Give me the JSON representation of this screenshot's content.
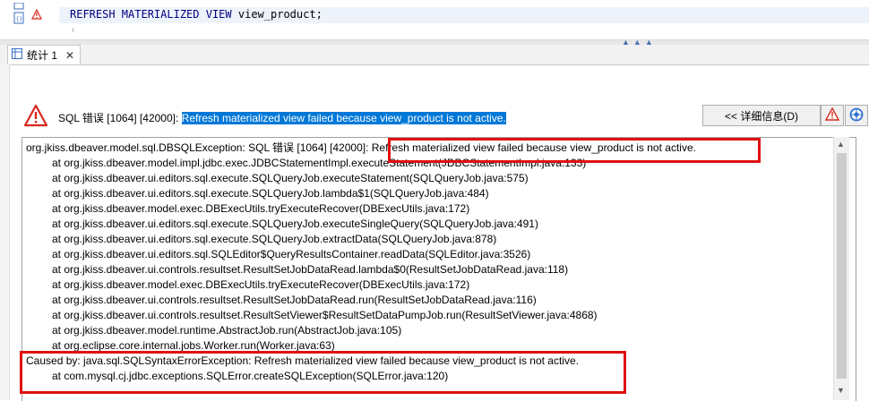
{
  "editor": {
    "code_keyword_1": "REFRESH MATERIALIZED",
    "code_keyword_2": "VIEW",
    "code_rest": "view_product;"
  },
  "results_tab": {
    "label": "统计 1"
  },
  "error": {
    "prefix": "SQL 错误 [1064] [42000]:",
    "selected_message": "Refresh materialized view failed because view_product is not active.",
    "details_button": "<< 详细信息(D)"
  },
  "trace": {
    "lines": [
      {
        "text": "org.jkiss.dbeaver.model.sql.DBSQLException: SQL 错误 [1064] [42000]: ",
        "tail": "Refresh materialized view failed because view_product is not active.",
        "indent": false
      },
      {
        "text": "at org.jkiss.dbeaver.model.impl.jdbc.exec.JDBCStatementImpl.executeStatement(JDBCStatementImpl.java:133)",
        "indent": true
      },
      {
        "text": "at org.jkiss.dbeaver.ui.editors.sql.execute.SQLQueryJob.executeStatement(SQLQueryJob.java:575)",
        "indent": true
      },
      {
        "text": "at org.jkiss.dbeaver.ui.editors.sql.execute.SQLQueryJob.lambda$1(SQLQueryJob.java:484)",
        "indent": true
      },
      {
        "text": "at org.jkiss.dbeaver.model.exec.DBExecUtils.tryExecuteRecover(DBExecUtils.java:172)",
        "indent": true
      },
      {
        "text": "at org.jkiss.dbeaver.ui.editors.sql.execute.SQLQueryJob.executeSingleQuery(SQLQueryJob.java:491)",
        "indent": true
      },
      {
        "text": "at org.jkiss.dbeaver.ui.editors.sql.execute.SQLQueryJob.extractData(SQLQueryJob.java:878)",
        "indent": true
      },
      {
        "text": "at org.jkiss.dbeaver.ui.editors.sql.SQLEditor$QueryResultsContainer.readData(SQLEditor.java:3526)",
        "indent": true
      },
      {
        "text": "at org.jkiss.dbeaver.ui.controls.resultset.ResultSetJobDataRead.lambda$0(ResultSetJobDataRead.java:118)",
        "indent": true
      },
      {
        "text": "at org.jkiss.dbeaver.model.exec.DBExecUtils.tryExecuteRecover(DBExecUtils.java:172)",
        "indent": true
      },
      {
        "text": "at org.jkiss.dbeaver.ui.controls.resultset.ResultSetJobDataRead.run(ResultSetJobDataRead.java:116)",
        "indent": true
      },
      {
        "text": "at org.jkiss.dbeaver.ui.controls.resultset.ResultSetViewer$ResultSetDataPumpJob.run(ResultSetViewer.java:4868)",
        "indent": true
      },
      {
        "text": "at org.jkiss.dbeaver.model.runtime.AbstractJob.run(AbstractJob.java:105)",
        "indent": true
      },
      {
        "text": "at org.eclipse.core.internal.jobs.Worker.run(Worker.java:63)",
        "indent": true
      },
      {
        "text": "Caused by: java.sql.SQLSyntaxErrorException: Refresh materialized view failed because view_product is not active.",
        "indent": false
      },
      {
        "text": "at com.mysql.cj.jdbc.exceptions.SQLError.createSQLException(SQLError.java:120)",
        "indent": true
      }
    ]
  },
  "icons": {
    "error_marker": "error-marker-icon",
    "warning": "warning-triangle-icon",
    "error_log": "error-log-icon",
    "help": "help-icon"
  },
  "colors": {
    "selection": "#0078d7",
    "highlight_box": "#e01010",
    "keyword": "#00007f"
  }
}
